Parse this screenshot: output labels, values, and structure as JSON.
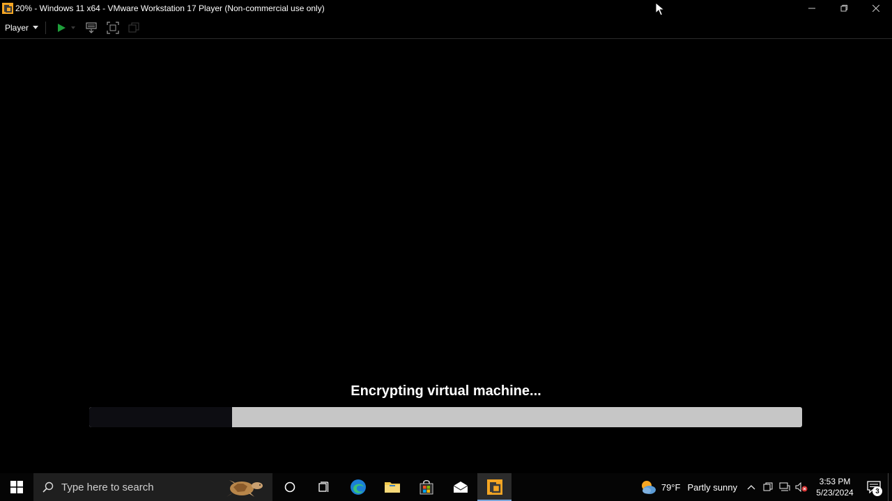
{
  "window": {
    "title": "20% - Windows 11 x64 - VMware Workstation 17 Player (Non-commercial use only)",
    "app_icon": "vmware-icon",
    "controls": {
      "minimize": "─",
      "restore": "❐",
      "close": "✕"
    }
  },
  "toolbar": {
    "player_menu": "Player",
    "buttons": [
      "play-icon",
      "send-ctrl-alt-del-icon",
      "fullscreen-icon",
      "unity-icon"
    ]
  },
  "vm": {
    "status": "Encrypting virtual machine...",
    "progress_fraction": 0.2
  },
  "taskbar": {
    "search_placeholder": "Type here to search",
    "pinned": [
      "cortana-icon",
      "task-view-icon",
      "edge-icon",
      "file-explorer-icon",
      "store-icon",
      "mail-icon",
      "vmware-icon"
    ],
    "weather": {
      "temp": "79°F",
      "condition": "Partly sunny"
    },
    "clock": {
      "time": "3:53 PM",
      "date": "5/23/2024"
    },
    "notifications_count": "3"
  },
  "colors": {
    "progress_track": "#c6c6c6",
    "progress_fill": "#0d0d12",
    "play_green": "#1e9e3a",
    "vmware_orange": "#f5a623"
  }
}
